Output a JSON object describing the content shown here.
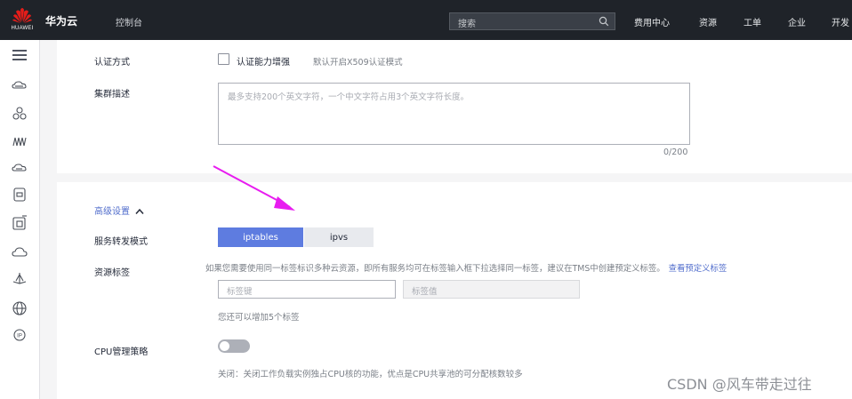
{
  "header": {
    "logo_text": "HUAWEI",
    "brand": "华为云",
    "console": "控制台",
    "search_placeholder": "搜索",
    "nav": [
      "费用中心",
      "资源",
      "工单",
      "企业",
      "开发"
    ]
  },
  "rail": {
    "icons": [
      "menu-icon",
      "cloud-server-icon",
      "cluster-icon",
      "network-icon",
      "storage-icon",
      "database-icon",
      "container-icon",
      "cloud-icon",
      "ship-icon",
      "globe-icon",
      "ip-icon"
    ]
  },
  "auth": {
    "label": "认证方式",
    "checkbox_label": "认证能力增强",
    "hint": "默认开启X509认证模式"
  },
  "description": {
    "label": "集群描述",
    "placeholder": "最多支持200个英文字符，一个中文字符占用3个英文字符长度。",
    "counter": "0/200"
  },
  "advanced": {
    "toggle_label": "高级设置",
    "chevron": "up"
  },
  "service_mode": {
    "label": "服务转发模式",
    "options": [
      "iptables",
      "ipvs"
    ],
    "selected": "iptables"
  },
  "tags": {
    "label": "资源标签",
    "hint": "如果您需要使用同一标签标识多种云资源，即所有服务均可在标签输入框下拉选择同一标签，建议在TMS中创建预定义标签。",
    "link": "查看预定义标签",
    "key_placeholder": "标签键",
    "value_placeholder": "标签值",
    "remaining": "您还可以增加5个标签"
  },
  "cpu": {
    "label": "CPU管理策略",
    "toggle_state": "off",
    "hint": "关闭：关闭工作负载实例独占CPU核的功能，优点是CPU共享池的可分配核数较多"
  },
  "watermark": "CSDN @风车带走过往",
  "colors": {
    "header_bg": "#1f2329",
    "accent": "#5e7ce0",
    "link": "#526ecc",
    "arrow": "#e81cf0"
  }
}
